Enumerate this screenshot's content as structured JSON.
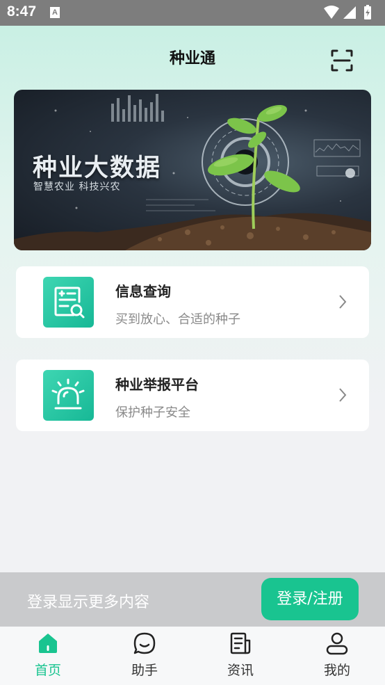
{
  "status_bar": {
    "time": "8:47",
    "notification_icon": "A"
  },
  "header": {
    "title": "种业通",
    "scan_icon": "scan-icon"
  },
  "banner": {
    "title": "种业大数据",
    "subtitle": "智慧农业 科技兴农"
  },
  "cards": [
    {
      "title": "信息查询",
      "subtitle": "买到放心、合适的种子",
      "icon": "document-search-icon"
    },
    {
      "title": "种业举报平台",
      "subtitle": "保护种子安全",
      "icon": "alarm-light-icon"
    }
  ],
  "login_prompt": {
    "text": "登录显示更多内容",
    "button_label": "登录/注册"
  },
  "tabs": [
    {
      "label": "首页",
      "icon": "home-icon",
      "active": true
    },
    {
      "label": "助手",
      "icon": "chat-icon",
      "active": false
    },
    {
      "label": "资讯",
      "icon": "news-icon",
      "active": false
    },
    {
      "label": "我的",
      "icon": "user-icon",
      "active": false
    }
  ],
  "colors": {
    "accent": "#19c490",
    "header_bg": "#c9f0e4",
    "status_bar": "#7d7d7d"
  }
}
